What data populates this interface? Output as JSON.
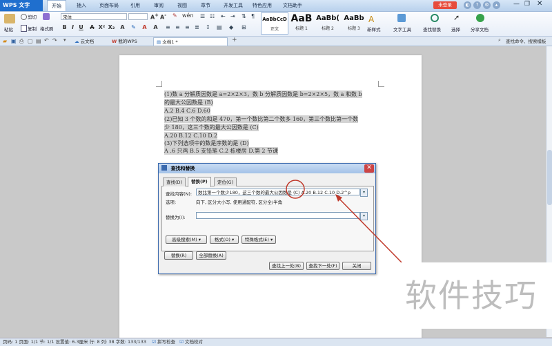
{
  "app": {
    "name": "WPS 文字",
    "login": "未登录"
  },
  "menu": [
    "开始",
    "插入",
    "页面布局",
    "引用",
    "审阅",
    "视图",
    "章节",
    "开发工具",
    "特色应用",
    "文档助手"
  ],
  "ribbon": {
    "cut": "剪切",
    "paste": "粘贴",
    "copy": "复制",
    "format_painter": "格式刷",
    "font_name": "宋体",
    "style_cards": [
      {
        "preview": "AaBbCcD",
        "label": "正文"
      },
      {
        "preview": "AaB",
        "label": "标题 1"
      },
      {
        "preview": "AaBb(",
        "label": "标题 2"
      },
      {
        "preview": "AaBb",
        "label": "标题 3"
      }
    ],
    "new_style": "新样式",
    "text_tools": "文字工具",
    "find_replace": "查找替换",
    "select": "选择",
    "share": "分享文档"
  },
  "tabs": {
    "cloud": "云文档",
    "my_wps": "我的WPS",
    "doc": "文档1 *",
    "search": "查找命令、搜索模板"
  },
  "document": {
    "lines": [
      "(1)数 a 分解质因数是 a=2×2×3，数 b 分解质因数是 b=2×2×5，数 a 和数 b",
      "的最大公因数是 (B)",
      "A.2  B.4  C.6  D.60",
      "(2)已知 3 个数的和是 470，第一个数比第二个数多 160，第三个数比第一个数",
      "少 180，这三个数的最大公因数是 (C)",
      "A.20  B.12  C.10  D.2",
      "(3)下列选项中的数是序数的是 (D)",
      "A .6 只鸡    B.5 支铅笔    C.2 栋楼房    D.第 2 节课"
    ]
  },
  "dialog": {
    "title": "查找和替换",
    "tabs": [
      "查找(D)",
      "替换(P)",
      "定位(G)"
    ],
    "find_label": "查找内容(N):",
    "find_value": "数比第一个数少180，这三个数的最大公因数是 (C)  A.20  B.12  C.10  D.2^p",
    "options_label": "选项:",
    "options_value": "向下, 区分大小写, 使用通配符, 区分全/半角",
    "replace_label": "替换为(I):",
    "replace_value": "",
    "advanced": "高级搜索(M) ▾",
    "format": "格式(O) ▾",
    "special": "特殊格式(E) ▾",
    "replace_btn": "替换(R)",
    "replace_all": "全部替换(A)",
    "find_prev": "查找上一处(B)",
    "find_next": "查找下一处(F)",
    "close": "关闭"
  },
  "status": {
    "text": "页码: 1  页面: 1/1  节: 1/1  设置值: 6.3厘米  行: 8  列: 38  字数: 133/133",
    "spell": "拼写检查",
    "proof": "文档校对"
  },
  "watermark": "软件技巧",
  "colors": {
    "accent": "#1f6fce",
    "annotation": "#c0392b",
    "dialog_border": "#3a69ad"
  }
}
